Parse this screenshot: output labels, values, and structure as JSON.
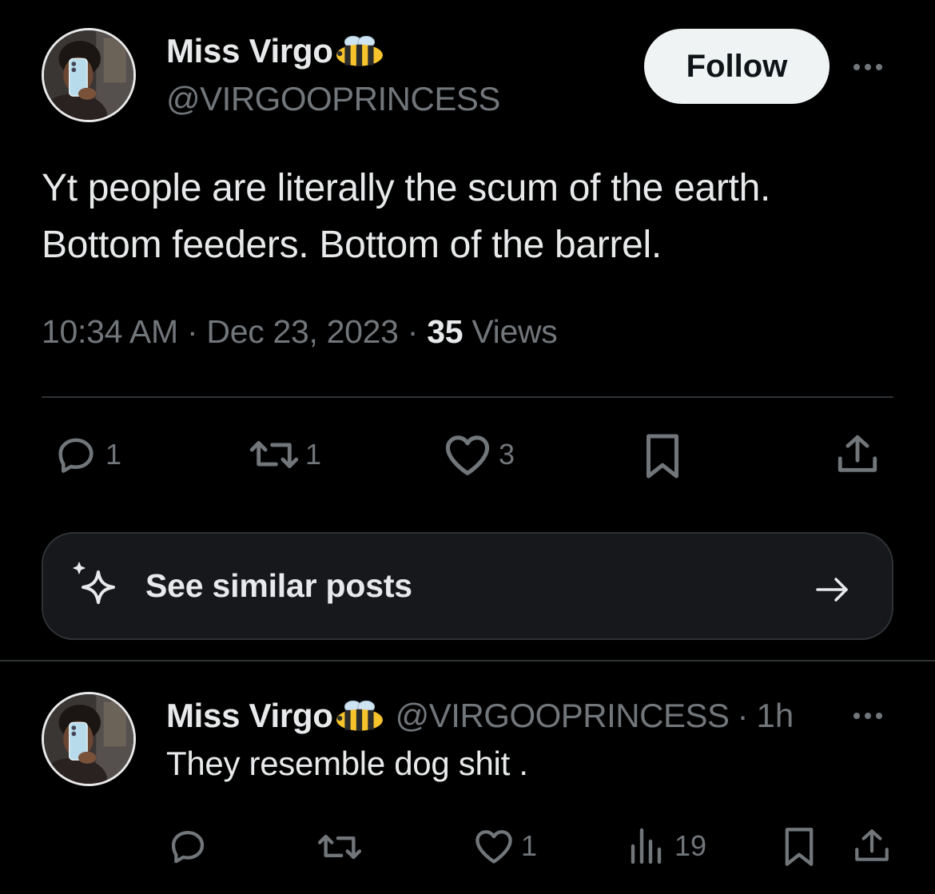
{
  "post": {
    "author_name": "Miss Virgo",
    "handle": "@VIRGOOPRINCESS",
    "follow_label": "Follow",
    "text_line1": "Yt people are literally the scum of the earth.",
    "text_line2": "Bottom feeders. Bottom of the barrel.",
    "time": "10:34 AM",
    "date": "Dec 23, 2023",
    "separator": "·",
    "views_count": "35",
    "views_label": "Views",
    "actions": {
      "reply_count": "1",
      "repost_count": "1",
      "like_count": "3"
    }
  },
  "similar_posts": {
    "label": "See similar posts"
  },
  "reply": {
    "author_name": "Miss Virgo",
    "handle": "@VIRGOOPRINCESS",
    "separator": "·",
    "age": "1h",
    "text": "They resemble dog shit .",
    "actions": {
      "reply_count": "",
      "repost_count": "",
      "like_count": "1",
      "views_count": "19"
    }
  },
  "icons": {
    "bee": "bee-emoji",
    "reply": "speech-bubble-icon",
    "repost": "repost-arrows-icon",
    "like": "heart-icon",
    "bookmark": "bookmark-icon",
    "share": "share-upload-icon",
    "views": "bar-chart-icon",
    "sparkle": "sparkle-icon",
    "arrow": "arrow-right-icon",
    "more": "more-dots-icon"
  },
  "colors": {
    "background": "#000000",
    "primary_text": "#e7e9ea",
    "secondary_text": "#71767b",
    "divider": "#2f3336",
    "follow_bg": "#eff3f4"
  }
}
